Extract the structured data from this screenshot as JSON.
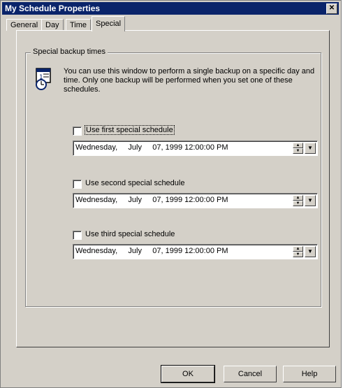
{
  "window": {
    "title": "My Schedule Properties",
    "close_glyph": "✕"
  },
  "tabs": [
    {
      "label": "General"
    },
    {
      "label": "Day"
    },
    {
      "label": "Time"
    },
    {
      "label": "Special"
    }
  ],
  "groupbox": {
    "label": "Special backup times",
    "icon": "calendar-clock-icon",
    "description": "You can use this window to perform a single backup on a specific day and time. Only one backup will be performed when you set one of these schedules."
  },
  "schedules": [
    {
      "label": "Use first special schedule",
      "checked": false,
      "value": "Wednesday,     July     07, 1999 12:00:00 PM"
    },
    {
      "label": "Use second special schedule",
      "checked": false,
      "value": "Wednesday,     July     07, 1999 12:00:00 PM"
    },
    {
      "label": "Use third special schedule",
      "checked": false,
      "value": "Wednesday,     July     07, 1999 12:00:00 PM"
    }
  ],
  "buttons": {
    "ok": "OK",
    "cancel": "Cancel",
    "help": "Help"
  }
}
